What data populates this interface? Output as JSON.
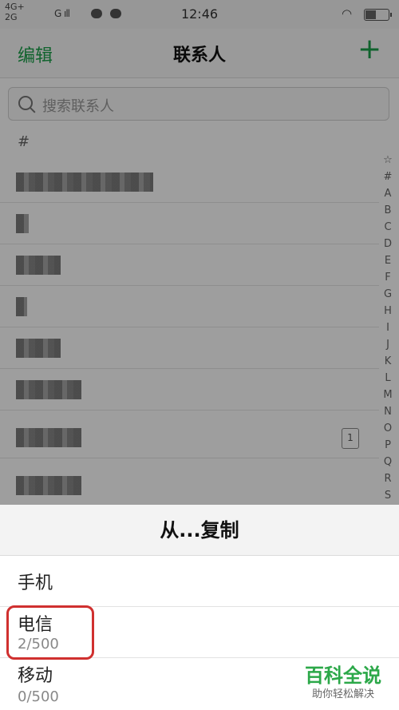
{
  "status_bar": {
    "network_line1": "4G+",
    "network_line2": "2G",
    "network_g": "G",
    "time": "12:46"
  },
  "header": {
    "edit_label": "编辑",
    "title": "联系人",
    "add_label": "+"
  },
  "search": {
    "placeholder": "搜索联系人"
  },
  "contacts": {
    "section": "#"
  },
  "sim_label": "1",
  "alpha_index": [
    "☆",
    "#",
    "A",
    "B",
    "C",
    "D",
    "E",
    "F",
    "G",
    "H",
    "I",
    "J",
    "K",
    "L",
    "M",
    "N",
    "O",
    "P",
    "Q",
    "R",
    "S"
  ],
  "sheet": {
    "title": "从...复制",
    "options": [
      {
        "label": "手机",
        "sub": ""
      },
      {
        "label": "电信",
        "sub": "2/500"
      },
      {
        "label": "移动",
        "sub": "0/500"
      }
    ]
  },
  "watermark": {
    "brand": "百科全说",
    "slogan": "助你轻松解决"
  },
  "colors": {
    "accent": "#1aa04a",
    "highlight": "#d0302f"
  }
}
